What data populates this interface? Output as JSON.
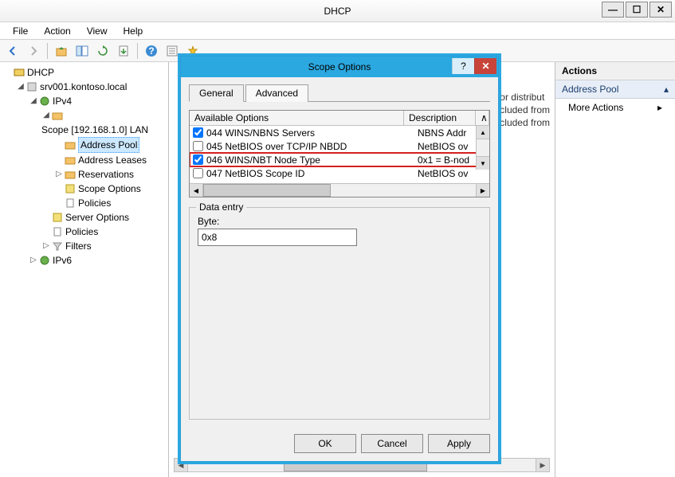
{
  "window": {
    "title": "DHCP"
  },
  "menu": {
    "file": "File",
    "action": "Action",
    "view": "View",
    "help": "Help"
  },
  "tree": {
    "root": "DHCP",
    "server": "srv001.kontoso.local",
    "ipv4": "IPv4",
    "scope": "Scope [192.168.1.0] LAN",
    "address_pool": "Address Pool",
    "address_leases": "Address Leases",
    "reservations": "Reservations",
    "scope_options": "Scope Options",
    "scope_policies": "Policies",
    "server_options": "Server Options",
    "policies": "Policies",
    "filters": "Filters",
    "ipv6": "IPv6"
  },
  "center": {
    "frag1": "or distribut",
    "frag2": "cluded from",
    "frag3": "cluded from"
  },
  "actions": {
    "header": "Actions",
    "group": "Address Pool",
    "more": "More Actions"
  },
  "dialog": {
    "title": "Scope Options",
    "tab_general": "General",
    "tab_advanced": "Advanced",
    "col_available": "Available Options",
    "col_description": "Description",
    "options": [
      {
        "checked": true,
        "label": "044 WINS/NBNS Servers",
        "desc": "NBNS Addr"
      },
      {
        "checked": false,
        "label": "045 NetBIOS over TCP/IP NBDD",
        "desc": "NetBIOS ov"
      },
      {
        "checked": true,
        "label": "046 WINS/NBT Node Type",
        "desc": "0x1 = B-nod",
        "highlight": true
      },
      {
        "checked": false,
        "label": "047 NetBIOS Scope ID",
        "desc": "NetBIOS ov"
      }
    ],
    "group_legend": "Data entry",
    "byte_label": "Byte:",
    "byte_value": "0x8",
    "btn_ok": "OK",
    "btn_cancel": "Cancel",
    "btn_apply": "Apply"
  }
}
